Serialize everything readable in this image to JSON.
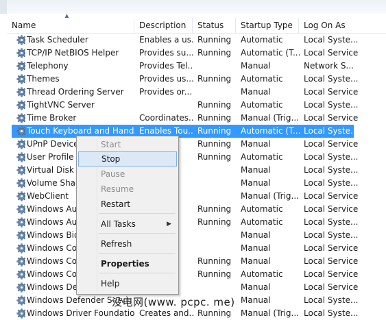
{
  "columns": {
    "name": "Name",
    "description": "Description",
    "status": "Status",
    "startup_type": "Startup Type",
    "log_on_as": "Log On As"
  },
  "services": [
    {
      "name": "Task Scheduler",
      "description": "Enables a us...",
      "status": "Running",
      "startup": "Automatic",
      "logon": "Local Syste..."
    },
    {
      "name": "TCP/IP NetBIOS Helper",
      "description": "Provides su...",
      "status": "Running",
      "startup": "Automatic (T...",
      "logon": "Local Service"
    },
    {
      "name": "Telephony",
      "description": "Provides Tel...",
      "status": "",
      "startup": "Manual",
      "logon": "Network S..."
    },
    {
      "name": "Themes",
      "description": "Provides us...",
      "status": "Running",
      "startup": "Automatic",
      "logon": "Local Syste..."
    },
    {
      "name": "Thread Ordering Server",
      "description": "Provides or...",
      "status": "",
      "startup": "Manual",
      "logon": "Local Service"
    },
    {
      "name": "TightVNC Server",
      "description": "",
      "status": "Running",
      "startup": "Automatic",
      "logon": "Local Syste..."
    },
    {
      "name": "Time Broker",
      "description": "Coordinates...",
      "status": "Running",
      "startup": "Manual (Trig...",
      "logon": "Local Service"
    },
    {
      "name": "Touch Keyboard and Hand...",
      "description": "Enables Tou...",
      "status": "Running",
      "startup": "Automatic (T...",
      "logon": "Local Syste..."
    },
    {
      "name": "UPnP Device H",
      "description": "",
      "status": "Running",
      "startup": "Manual",
      "logon": "Local Service"
    },
    {
      "name": "User Profile Se",
      "description": "",
      "status": "Running",
      "startup": "Automatic",
      "logon": "Local Syste..."
    },
    {
      "name": "Virtual Disk",
      "description": "",
      "status": "",
      "startup": "Manual",
      "logon": "Local Syste..."
    },
    {
      "name": "Volume Shado",
      "description": "",
      "status": "",
      "startup": "Manual",
      "logon": "Local Syste..."
    },
    {
      "name": "WebClient",
      "description": "",
      "status": "",
      "startup": "Manual (Trig...",
      "logon": "Local Service"
    },
    {
      "name": "Windows Aud",
      "description": "",
      "status": "Running",
      "startup": "Automatic",
      "logon": "Local Service"
    },
    {
      "name": "Windows Aud",
      "description": "",
      "status": "Running",
      "startup": "Automatic",
      "logon": "Local Syste..."
    },
    {
      "name": "Windows Bior",
      "description": "",
      "status": "",
      "startup": "Manual",
      "logon": "Local Syste..."
    },
    {
      "name": "Windows Colo",
      "description": "",
      "status": "",
      "startup": "Manual",
      "logon": "Local Service"
    },
    {
      "name": "Windows Con",
      "description": "",
      "status": "Running",
      "startup": "Manual",
      "logon": "Local Service"
    },
    {
      "name": "Windows Con",
      "description": "",
      "status": "Running",
      "startup": "Automatic",
      "logon": "Local Service"
    },
    {
      "name": "Windows Defe",
      "description": "",
      "status": "",
      "startup": "Manual",
      "logon": "Local Service"
    },
    {
      "name": "Windows Defender Servic",
      "description": "",
      "status": "",
      "startup": "Manual",
      "logon": "Local Syste..."
    },
    {
      "name": "Windows Driver Foundation...",
      "description": "Creates and...",
      "status": "Running",
      "startup": "Manual (Trig...",
      "logon": "Local Syste..."
    }
  ],
  "selected_index": 7,
  "context_menu": {
    "start": "Start",
    "stop": "Stop",
    "pause": "Pause",
    "resume": "Resume",
    "restart": "Restart",
    "all_tasks": "All Tasks",
    "refresh": "Refresh",
    "properties": "Properties",
    "help": "Help"
  },
  "watermark": "没电网(www. pcpc. me)",
  "colors": {
    "selection": "#3399ff",
    "menu_hot": "#dbe8f6",
    "menu_bg": "#f0f0f0"
  },
  "icons": {
    "service": "gear-icon",
    "sort": "sort-ascending-icon",
    "submenu": "submenu-arrow-icon"
  }
}
